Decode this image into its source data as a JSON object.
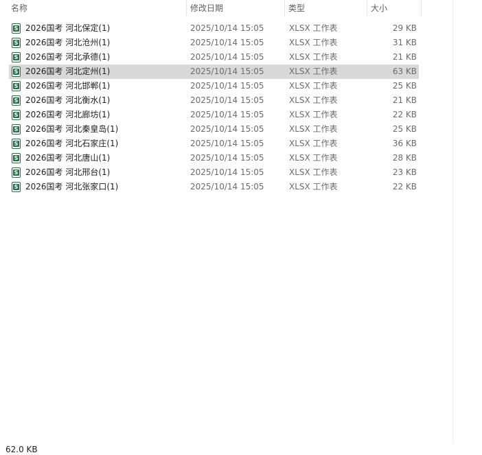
{
  "columns": {
    "name": "名称",
    "date": "修改日期",
    "type": "类型",
    "size": "大小",
    "sort_indicator": "^"
  },
  "icon": "excel-sheet-icon",
  "icon_glyph": "S",
  "accent_color": "#1e7145",
  "selected_row_color": "#d9d9d9",
  "files": [
    {
      "name": "2026国考 河北保定(1)",
      "date": "2025/10/14 15:05",
      "type": "XLSX 工作表",
      "size": "29 KB",
      "selected": false
    },
    {
      "name": "2026国考 河北沧州(1)",
      "date": "2025/10/14 15:05",
      "type": "XLSX 工作表",
      "size": "31 KB",
      "selected": false
    },
    {
      "name": "2026国考 河北承德(1)",
      "date": "2025/10/14 15:05",
      "type": "XLSX 工作表",
      "size": "21 KB",
      "selected": false
    },
    {
      "name": "2026国考 河北定州(1)",
      "date": "2025/10/14 15:05",
      "type": "XLSX 工作表",
      "size": "63 KB",
      "selected": true
    },
    {
      "name": "2026国考 河北邯郸(1)",
      "date": "2025/10/14 15:05",
      "type": "XLSX 工作表",
      "size": "25 KB",
      "selected": false
    },
    {
      "name": "2026国考 河北衡水(1)",
      "date": "2025/10/14 15:05",
      "type": "XLSX 工作表",
      "size": "21 KB",
      "selected": false
    },
    {
      "name": "2026国考 河北廊坊(1)",
      "date": "2025/10/14 15:05",
      "type": "XLSX 工作表",
      "size": "22 KB",
      "selected": false
    },
    {
      "name": "2026国考 河北秦皇岛(1)",
      "date": "2025/10/14 15:05",
      "type": "XLSX 工作表",
      "size": "25 KB",
      "selected": false
    },
    {
      "name": "2026国考 河北石家庄(1)",
      "date": "2025/10/14 15:05",
      "type": "XLSX 工作表",
      "size": "36 KB",
      "selected": false
    },
    {
      "name": "2026国考 河北唐山(1)",
      "date": "2025/10/14 15:05",
      "type": "XLSX 工作表",
      "size": "28 KB",
      "selected": false
    },
    {
      "name": "2026国考 河北邢台(1)",
      "date": "2025/10/14 15:05",
      "type": "XLSX 工作表",
      "size": "23 KB",
      "selected": false
    },
    {
      "name": "2026国考 河北张家口(1)",
      "date": "2025/10/14 15:05",
      "type": "XLSX 工作表",
      "size": "22 KB",
      "selected": false
    }
  ],
  "status_bar": {
    "selection_size": "62.0 KB"
  }
}
